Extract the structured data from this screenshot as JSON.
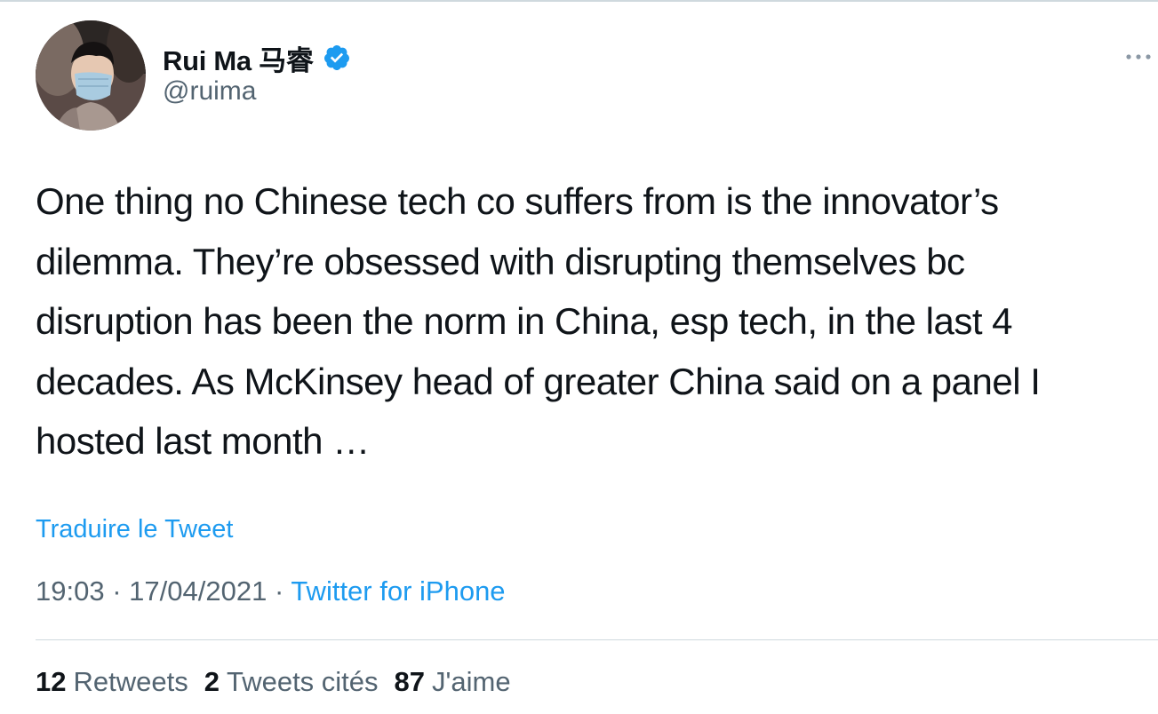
{
  "author": {
    "name": "Rui Ma 马睿",
    "handle": "@ruima",
    "verified": true,
    "avatar": "avatar-photo-masked-person"
  },
  "more_icon": "more-horizontal-icon",
  "tweet": {
    "lines": [
      "One thing no Chinese tech co suffers from is the innovator’s",
      "dilemma. They’re obsessed with disrupting themselves bc",
      "disruption has been the norm in China, esp tech, in the last 4",
      "decades. As McKinsey head of greater China said on a panel I",
      "hosted last month …"
    ]
  },
  "translate_label": "Traduire le Tweet",
  "meta": {
    "time": "19:03",
    "separator": "·",
    "date": "17/04/2021",
    "source": "Twitter for iPhone"
  },
  "stats": {
    "retweets_count": "12",
    "retweets_label": "Retweets",
    "quotes_count": "2",
    "quotes_label": "Tweets cités",
    "likes_count": "87",
    "likes_label": "J'aime"
  },
  "colors": {
    "accent": "#1d9bf0",
    "text": "#0f1419",
    "secondary": "#536471",
    "border": "#cfd9de"
  }
}
